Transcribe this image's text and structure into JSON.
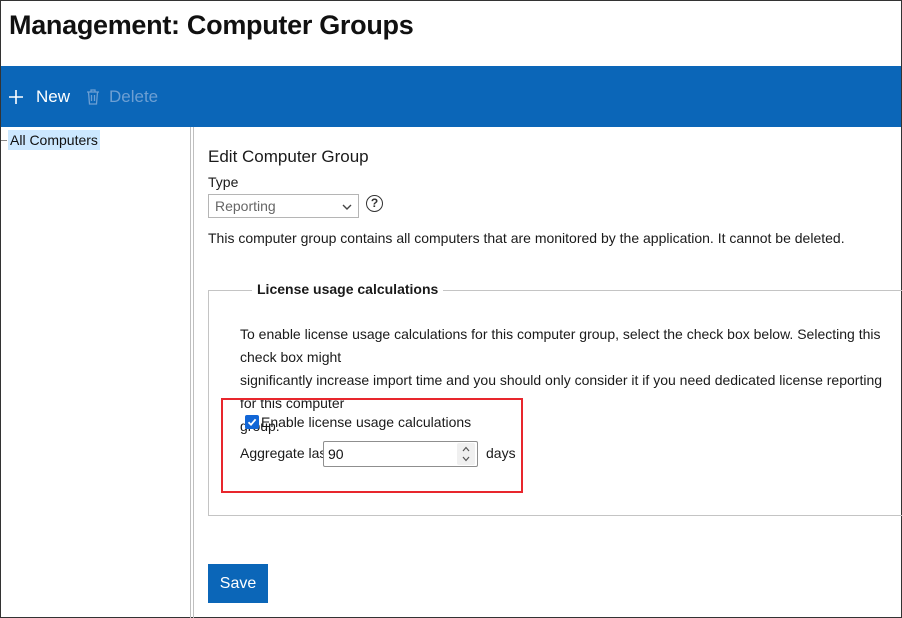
{
  "page": {
    "title": "Management: Computer Groups"
  },
  "toolbar": {
    "new_label": "New",
    "new_icon": "plus-icon",
    "delete_label": "Delete",
    "delete_icon": "trash-icon",
    "background": "#0b66b8"
  },
  "tree": {
    "items": [
      {
        "label": "All Computers",
        "selected": true
      }
    ]
  },
  "form": {
    "section_title": "Edit Computer Group",
    "type_label": "Type",
    "type_value": "Reporting",
    "help_icon": "question-circle-icon",
    "description": "This computer group contains all computers that are monitored by the application. It cannot be deleted."
  },
  "license": {
    "legend": "License usage calculations",
    "info_lines": [
      "To enable license usage calculations for this computer group, select the check box below. Selecting this check box might",
      "significantly increase import time and you should only consider it if you need dedicated license reporting for this computer",
      "group."
    ],
    "checkbox_label": "Enable license usage calculations",
    "checkbox_checked": true,
    "aggregate_label": "Aggregate last",
    "aggregate_value": "90",
    "days_label": "days",
    "highlight_color": "#e8262d"
  },
  "actions": {
    "save_label": "Save"
  }
}
